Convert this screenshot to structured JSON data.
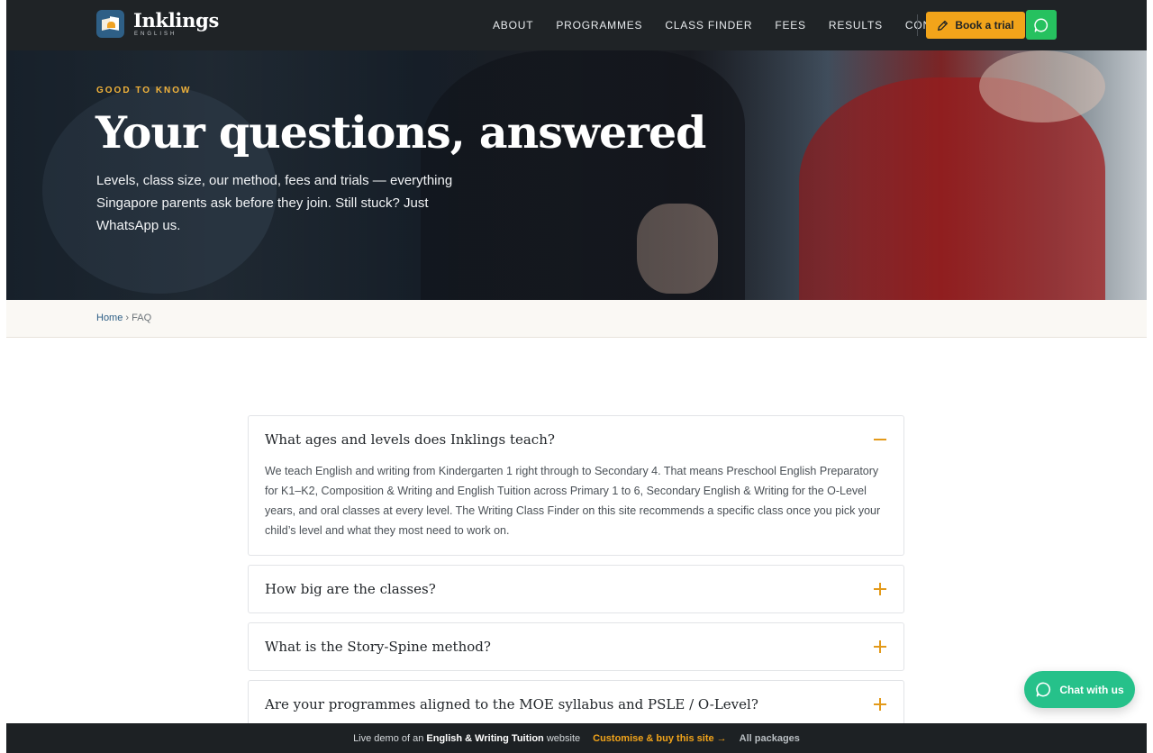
{
  "brand": {
    "name": "Inklings",
    "sub": "ENGLISH"
  },
  "nav": {
    "items": [
      "ABOUT",
      "PROGRAMMES",
      "CLASS FINDER",
      "FEES",
      "RESULTS",
      "CONTACT"
    ]
  },
  "header": {
    "book_trial": "Book a trial"
  },
  "hero": {
    "eyebrow": "GOOD TO KNOW",
    "title": "Your questions, answered",
    "lede": "Levels, class size, our method, fees and trials — everything Singapore parents ask before they join. Still stuck? Just WhatsApp us."
  },
  "breadcrumb": {
    "home": "Home",
    "sep": "›",
    "current": "FAQ"
  },
  "faq": [
    {
      "question": "What ages and levels does Inklings teach?",
      "answer": "We teach English and writing from Kindergarten 1 right through to Secondary 4. That means Preschool English Preparatory for K1–K2, Composition & Writing and English Tuition across Primary 1 to 6, Secondary English & Writing for the O-Level years, and oral classes at every level. The Writing Class Finder on this site recommends a specific class once you pick your child’s level and what they most need to work on.",
      "open": true
    },
    {
      "question": "How big are the classes?",
      "open": false
    },
    {
      "question": "What is the Story-Spine method?",
      "open": false
    },
    {
      "question": "Are your programmes aligned to the MOE syllabus and PSLE / O-Level?",
      "open": false
    }
  ],
  "chat": {
    "label": "Chat with us"
  },
  "demo_bar": {
    "prefix": "Live demo of an",
    "site_type": "English & Writing Tuition",
    "suffix": "website",
    "cta": "Customise & buy this site →",
    "packages": "All packages"
  },
  "colors": {
    "accent": "#f2a41a",
    "whatsapp": "#26c15f",
    "dark": "#1f2326",
    "link": "#2e5f86"
  }
}
